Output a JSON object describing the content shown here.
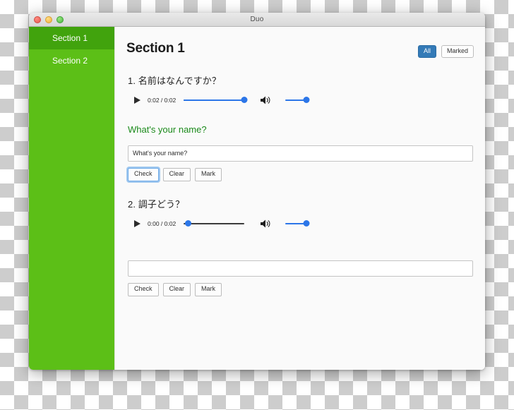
{
  "window": {
    "title": "Duo",
    "traffic_lights": [
      "close-button",
      "minimize-button",
      "zoom-button"
    ]
  },
  "sidebar": {
    "items": [
      {
        "label": "Section 1",
        "active": true
      },
      {
        "label": "Section 2",
        "active": false
      }
    ]
  },
  "main": {
    "page_title": "Section 1",
    "filters": [
      {
        "label": "All",
        "selected": true
      },
      {
        "label": "Marked",
        "selected": false
      }
    ],
    "questions": [
      {
        "title": "1. 名前はなんですか？",
        "player": {
          "play_label": "play-icon",
          "time": "0:02 / 0:02",
          "seek_percent": 100,
          "volume_percent": 100,
          "speaker_label": "speaker-icon"
        },
        "answer_text": "What's your name?",
        "input_value": "What's your name?",
        "input_placeholder": "",
        "buttons": [
          {
            "label": "Check",
            "focused": true
          },
          {
            "label": "Clear",
            "focused": false
          },
          {
            "label": "Mark",
            "focused": false
          }
        ]
      },
      {
        "title": "2. 調子どう？",
        "player": {
          "play_label": "play-icon",
          "time": "0:00 / 0:02",
          "seek_percent": 0,
          "volume_percent": 100,
          "speaker_label": "speaker-icon"
        },
        "answer_text": "",
        "input_value": "",
        "input_placeholder": "",
        "buttons": [
          {
            "label": "Check",
            "focused": false
          },
          {
            "label": "Clear",
            "focused": false
          },
          {
            "label": "Mark",
            "focused": false
          }
        ]
      }
    ]
  },
  "colors": {
    "sidebar_bg": "#5cbf17",
    "sidebar_active_bg": "#41a30d",
    "accent_blue": "#337ab7",
    "player_blue": "#2c76e8",
    "answer_green": "#1b8a1b"
  }
}
